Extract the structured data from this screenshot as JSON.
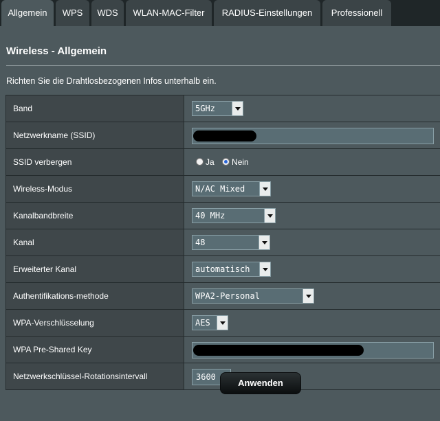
{
  "tabs": [
    {
      "label": "Allgemein",
      "active": true
    },
    {
      "label": "WPS",
      "active": false
    },
    {
      "label": "WDS",
      "active": false
    },
    {
      "label": "WLAN-MAC-Filter",
      "active": false
    },
    {
      "label": "RADIUS-Einstellungen",
      "active": false
    },
    {
      "label": "Professionell",
      "active": false
    }
  ],
  "page": {
    "title": "Wireless - Allgemein",
    "description": "Richten Sie die Drahtlosbezogenen Infos unterhalb ein."
  },
  "form": {
    "band": {
      "label": "Band",
      "value": "5GHz"
    },
    "ssid": {
      "label": "Netzwerkname (SSID)",
      "value": ""
    },
    "hide_ssid": {
      "label": "SSID verbergen",
      "option_yes": "Ja",
      "option_no": "Nein",
      "selected": "Nein"
    },
    "wireless_mode": {
      "label": "Wireless-Modus",
      "value": "N/AC Mixed"
    },
    "channel_bandwidth": {
      "label": "Kanalbandbreite",
      "value": "40 MHz"
    },
    "channel": {
      "label": "Kanal",
      "value": "48"
    },
    "extension_channel": {
      "label": "Erweiterter Kanal",
      "value": "automatisch"
    },
    "auth_method": {
      "label": "Authentifikations-methode",
      "value": "WPA2-Personal"
    },
    "wpa_encryption": {
      "label": "WPA-Verschlüsselung",
      "value": "AES"
    },
    "wpa_psk": {
      "label": "WPA Pre-Shared Key",
      "value": ""
    },
    "key_rotation": {
      "label": "Netzwerkschlüssel-Rotationsintervall",
      "value": "3600"
    }
  },
  "buttons": {
    "apply": "Anwenden"
  },
  "colors": {
    "background": "#1f2628",
    "panel": "#4d595d",
    "label_cell": "#3f474a",
    "input": "#596d74",
    "radio_checked": "#2a66d8"
  }
}
